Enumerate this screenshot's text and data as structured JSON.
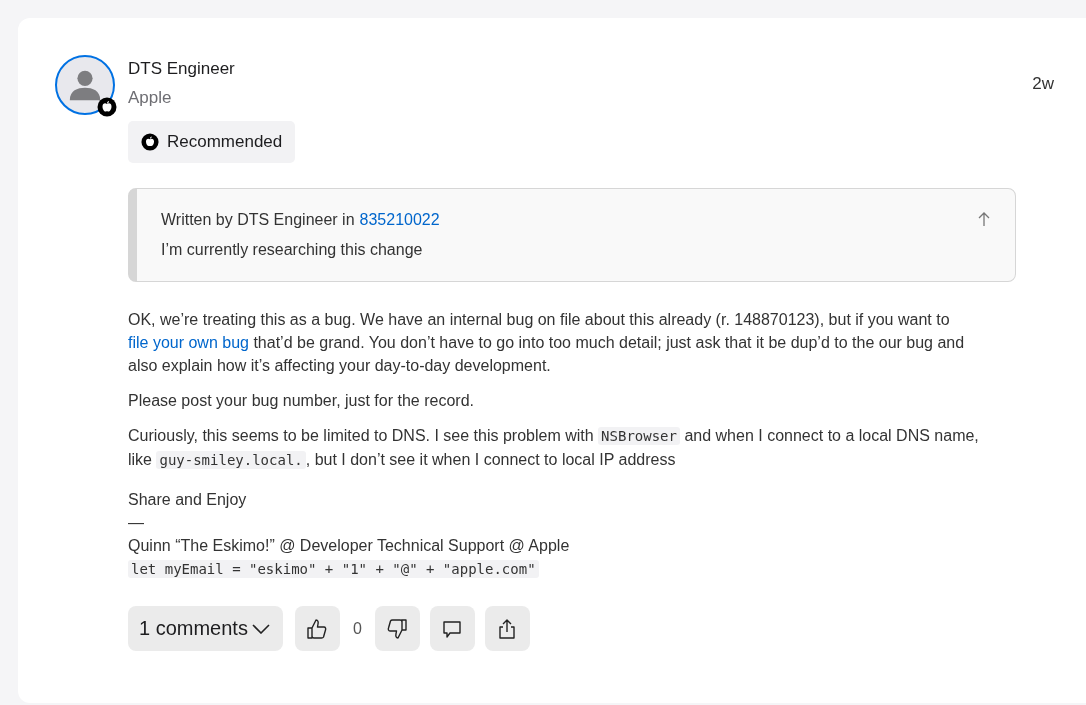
{
  "post": {
    "author": "DTS Engineer",
    "organization": "Apple",
    "age": "2w",
    "badge": "Recommended",
    "quote": {
      "prefix": "Written by DTS Engineer in",
      "link": "835210022",
      "text": "I’m currently researching this change"
    },
    "paragraphs": [
      [
        {
          "kind": "text",
          "text": "OK, we’re treating this as a bug. We have an internal bug on file about this already (r. 148870123), but if you want to "
        },
        {
          "kind": "link",
          "text": "file your own bug"
        },
        {
          "kind": "text",
          "text": " that’d be grand. You don’t have to go into too much detail; just ask that it be dup’d to the our bug and also explain how it’s affecting your day-to-day development."
        }
      ],
      [
        {
          "kind": "text",
          "text": "Please post your bug number, just for the record."
        }
      ],
      [
        {
          "kind": "text",
          "text": "Curiously, this seems to be limited to DNS. I see this problem with "
        },
        {
          "kind": "code",
          "text": "NSBrowser"
        },
        {
          "kind": "text",
          "text": " and when I connect to a local DNS name, like "
        },
        {
          "kind": "code",
          "text": "guy-smiley.local."
        },
        {
          "kind": "text",
          "text": ", but I don’t see it when I connect to local IP address"
        }
      ]
    ],
    "signature": [
      {
        "kind": "text",
        "text": "Share and Enjoy"
      },
      {
        "kind": "text",
        "text": "—"
      },
      {
        "kind": "text",
        "text": "Quinn “The Eskimo!” @ Developer Technical Support @ Apple"
      },
      {
        "kind": "code",
        "text": "let myEmail = \"eskimo\" + \"1\" + \"@\" + \"apple.com\""
      }
    ],
    "comments": "1 comments",
    "votes": "0"
  }
}
